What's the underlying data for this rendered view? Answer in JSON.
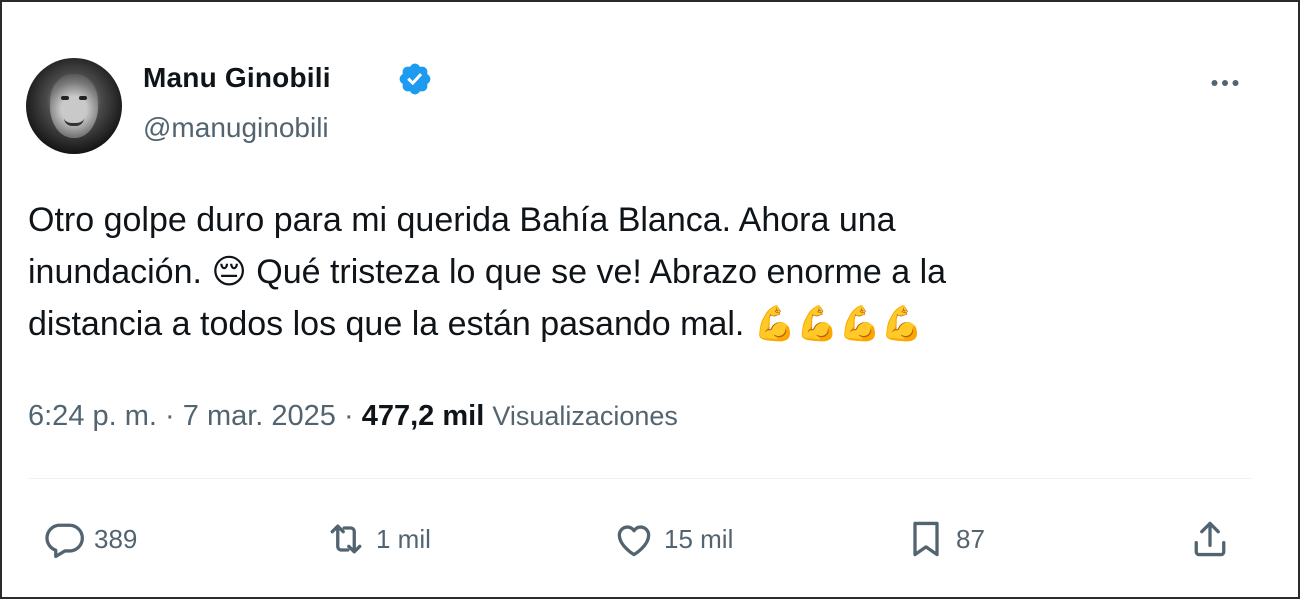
{
  "tweet": {
    "author_name": "Manu Ginobili",
    "handle": "@manuginobili",
    "verified_color": "#1d9bf0",
    "text_lines": [
      "Otro golpe duro para mi querida Bahía Blanca. Ahora una",
      "inundación. 😔 Qué tristeza lo que se ve! Abrazo enorme a la",
      "distancia a todos los que la están pasando mal. 💪💪💪💪"
    ],
    "time": "6:24 p. m.",
    "separator": "·",
    "date": "7 mar. 2025",
    "views_count": "477,2 mil",
    "views_label": "Visualizaciones",
    "more_icon": "more-horizontal-icon"
  },
  "actions": {
    "replies": "389",
    "reposts": "1 mil",
    "likes": "15 mil",
    "bookmarks": "87"
  }
}
